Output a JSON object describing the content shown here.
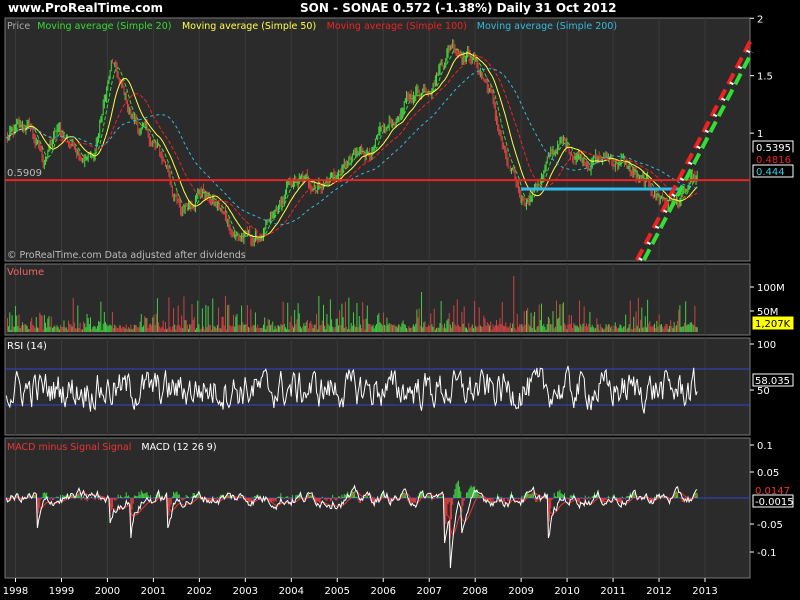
{
  "header": {
    "site": "www.ProRealTime.com",
    "quote": "SON - SONAE   0.572 (-1.38%)   Daily  31 Oct 2012"
  },
  "panels": {
    "price": {
      "legend": [
        {
          "text": "Price",
          "color": "#aaaaaa"
        },
        {
          "text": "Moving average (Simple 20)",
          "color": "#33dd33"
        },
        {
          "text": "Moving average (Simple 50)",
          "color": "#ffff44"
        },
        {
          "text": "Moving average (Simple 100)",
          "color": "#ee2222"
        },
        {
          "text": "Moving average (Simple 200)",
          "color": "#33bbdd"
        }
      ],
      "footer": "© ProRealTime.com  Data adjusted after dividends",
      "level_label": "0.5909",
      "right_labels": [
        {
          "text": "0.5395",
          "bg": "#000000",
          "fg": "#ffffff",
          "border": "#ffffff"
        },
        {
          "text": "0.4816",
          "bg": "#000000",
          "fg": "#ee2222",
          "border": "#000000"
        },
        {
          "text": "0.444",
          "bg": "#000000",
          "fg": "#33ccdd",
          "border": "#ffffff"
        }
      ]
    },
    "volume": {
      "title": "Volume",
      "value_label": "1,207K"
    },
    "rsi": {
      "title": "RSI (14)",
      "value_label": "58.035"
    },
    "macd": {
      "title_parts": [
        {
          "text": "MACD minus Signal",
          "color": "#ee3333"
        },
        {
          "text": " Signal",
          "color": "#ee3333"
        },
        {
          "text": " MACD (12 26 9)",
          "color": "#ffffff"
        }
      ],
      "value_labels": [
        "0.0147",
        "-0.0015"
      ]
    }
  },
  "chart_data": {
    "type": "line",
    "series": [
      {
        "name": "Price",
        "values": [
          {
            "x": 1997.8,
            "y": 0.95
          },
          {
            "x": 1998.3,
            "y": 1.05
          },
          {
            "x": 1998.6,
            "y": 0.75
          },
          {
            "x": 1998.9,
            "y": 1.0
          },
          {
            "x": 1999.3,
            "y": 0.9
          },
          {
            "x": 1999.7,
            "y": 0.8
          },
          {
            "x": 2000.1,
            "y": 1.6
          },
          {
            "x": 2000.5,
            "y": 1.15
          },
          {
            "x": 2000.9,
            "y": 0.95
          },
          {
            "x": 2001.3,
            "y": 0.7
          },
          {
            "x": 2001.6,
            "y": 0.28
          },
          {
            "x": 2002.0,
            "y": 0.55
          },
          {
            "x": 2002.4,
            "y": 0.35
          },
          {
            "x": 2002.8,
            "y": 0.12
          },
          {
            "x": 2003.2,
            "y": 0.06
          },
          {
            "x": 2003.6,
            "y": 0.2
          },
          {
            "x": 2004.0,
            "y": 0.55
          },
          {
            "x": 2004.4,
            "y": 0.55
          },
          {
            "x": 2005.0,
            "y": 0.65
          },
          {
            "x": 2005.5,
            "y": 0.8
          },
          {
            "x": 2006.0,
            "y": 0.95
          },
          {
            "x": 2006.6,
            "y": 1.3
          },
          {
            "x": 2007.0,
            "y": 1.45
          },
          {
            "x": 2007.5,
            "y": 1.8
          },
          {
            "x": 2007.9,
            "y": 1.7
          },
          {
            "x": 2008.3,
            "y": 1.4
          },
          {
            "x": 2008.7,
            "y": 0.7
          },
          {
            "x": 2009.0,
            "y": 0.38
          },
          {
            "x": 2009.4,
            "y": 0.6
          },
          {
            "x": 2009.8,
            "y": 0.9
          },
          {
            "x": 2010.3,
            "y": 0.82
          },
          {
            "x": 2010.7,
            "y": 0.78
          },
          {
            "x": 2011.2,
            "y": 0.76
          },
          {
            "x": 2011.6,
            "y": 0.55
          },
          {
            "x": 2012.0,
            "y": 0.45
          },
          {
            "x": 2012.4,
            "y": 0.4
          },
          {
            "x": 2012.83,
            "y": 0.572
          }
        ]
      }
    ],
    "x_ticks": [
      "1998",
      "1999",
      "2000",
      "2001",
      "2002",
      "2003",
      "2004",
      "2005",
      "2006",
      "2007",
      "2008",
      "2009",
      "2010",
      "2011",
      "2012",
      "2013"
    ],
    "y_ticks": [
      "2",
      "1.5",
      "1"
    ],
    "horizontal_lines": [
      {
        "y": 0.5909,
        "color": "#ee2222"
      }
    ],
    "support_segment": {
      "x1": 2009.0,
      "x2": 2012.5,
      "y": 0.4,
      "color": "#33bbee"
    },
    "trend_channels": [
      {
        "color": "#ee2222",
        "x1": 2011.5,
        "x2": 2013.9
      },
      {
        "color": "#33dd33",
        "x1": 2011.7,
        "x2": 2014.1
      }
    ],
    "volume_ticks": [
      "100M",
      "50M"
    ],
    "rsi_ticks": [
      "100",
      "50"
    ],
    "rsi_levels": [
      70,
      30
    ],
    "macd_ticks": [
      "0.1",
      "0.05",
      "-0.05",
      "-0.1"
    ]
  }
}
